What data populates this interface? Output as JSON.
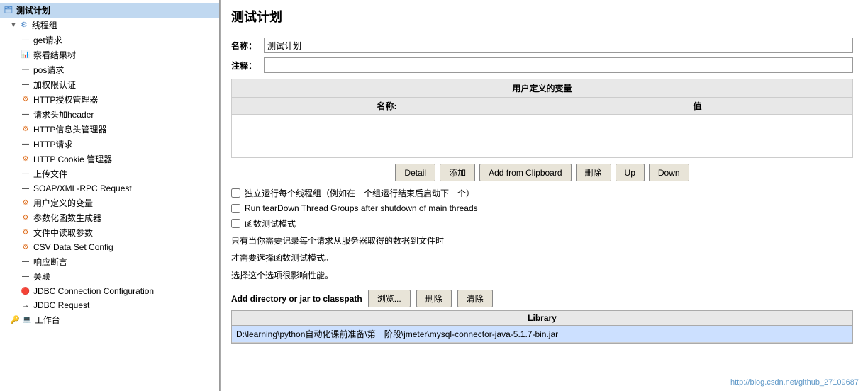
{
  "sidebar": {
    "items": [
      {
        "id": "test-plan",
        "label": "测试计划",
        "icon": "📋",
        "indent": 0,
        "selected": true
      },
      {
        "id": "thread-group",
        "label": "线程组",
        "icon": "⚙",
        "indent": 1
      },
      {
        "id": "get-request",
        "label": "get请求",
        "icon": "→",
        "indent": 2
      },
      {
        "id": "view-results-tree",
        "label": "察看结果树",
        "icon": "📊",
        "indent": 2
      },
      {
        "id": "pos-request",
        "label": "pos请求",
        "icon": "→",
        "indent": 2
      },
      {
        "id": "auth-manager",
        "label": "加权限认证",
        "icon": "🔒",
        "indent": 2
      },
      {
        "id": "http-auth",
        "label": "HTTP授权管理器",
        "icon": "🔒",
        "indent": 2
      },
      {
        "id": "add-header",
        "label": "请求头加header",
        "icon": "⚙",
        "indent": 2
      },
      {
        "id": "http-header",
        "label": "HTTP信息头管理器",
        "icon": "⚙",
        "indent": 2
      },
      {
        "id": "http-request",
        "label": "HTTP请求",
        "icon": "→",
        "indent": 2
      },
      {
        "id": "http-cookie",
        "label": "HTTP Cookie 管理器",
        "icon": "⚙",
        "indent": 2
      },
      {
        "id": "upload-file",
        "label": "上传文件",
        "icon": "→",
        "indent": 2
      },
      {
        "id": "soap-request",
        "label": "SOAP/XML-RPC Request",
        "icon": "→",
        "indent": 2
      },
      {
        "id": "user-vars",
        "label": "用户定义的变量",
        "icon": "📋",
        "indent": 2
      },
      {
        "id": "param-gen",
        "label": "参数化函数生成器",
        "icon": "⚙",
        "indent": 2
      },
      {
        "id": "csv-extract",
        "label": "文件中读取参数",
        "icon": "⚙",
        "indent": 2
      },
      {
        "id": "csv-config",
        "label": "CSV Data Set Config",
        "icon": "⚙",
        "indent": 2
      },
      {
        "id": "response-assert",
        "label": "响应断言",
        "icon": "⚙",
        "indent": 2
      },
      {
        "id": "assertion",
        "label": "关联",
        "icon": "⚙",
        "indent": 2
      },
      {
        "id": "jdbc-config",
        "label": "JDBC Connection Configuration",
        "icon": "🔴",
        "indent": 2
      },
      {
        "id": "jdbc-request",
        "label": "JDBC Request",
        "icon": "→",
        "indent": 2
      },
      {
        "id": "workbench",
        "label": "工作台",
        "icon": "💻",
        "indent": 0
      }
    ]
  },
  "main": {
    "title": "测试计划",
    "name_label": "名称：",
    "name_value": "测试计划",
    "comment_label": "注释：",
    "comment_value": "",
    "user_vars_section": "用户定义的变量",
    "table": {
      "col_name": "名称:",
      "col_value": "值"
    },
    "buttons": {
      "detail": "Detail",
      "add": "添加",
      "add_from_clipboard": "Add from Clipboard",
      "delete": "删除",
      "up": "Up",
      "down": "Down"
    },
    "checkbox1_label": "独立运行每个线程组（例如在一个组运行结束后启动下一个）",
    "checkbox2_label": "Run tearDown Thread Groups after shutdown of main threads",
    "checkbox3_label": "函数测试模式",
    "info_text1": "只有当你需要记录每个请求从服务器取得的数据到文件时",
    "info_text2": "才需要选择函数测试模式。",
    "warning_text": "选择这个选项很影响性能。",
    "classpath_label": "Add directory or jar to classpath",
    "browse_btn": "浏览...",
    "remove_btn": "删除",
    "clear_btn": "清除",
    "library_header": "Library",
    "library_entry": "D:\\learning\\python自动化课前准备\\第一阶段\\jmeter\\mysql-connector-java-5.1.7-bin.jar"
  },
  "watermark": "http://blog.csdn.net/github_27109687"
}
